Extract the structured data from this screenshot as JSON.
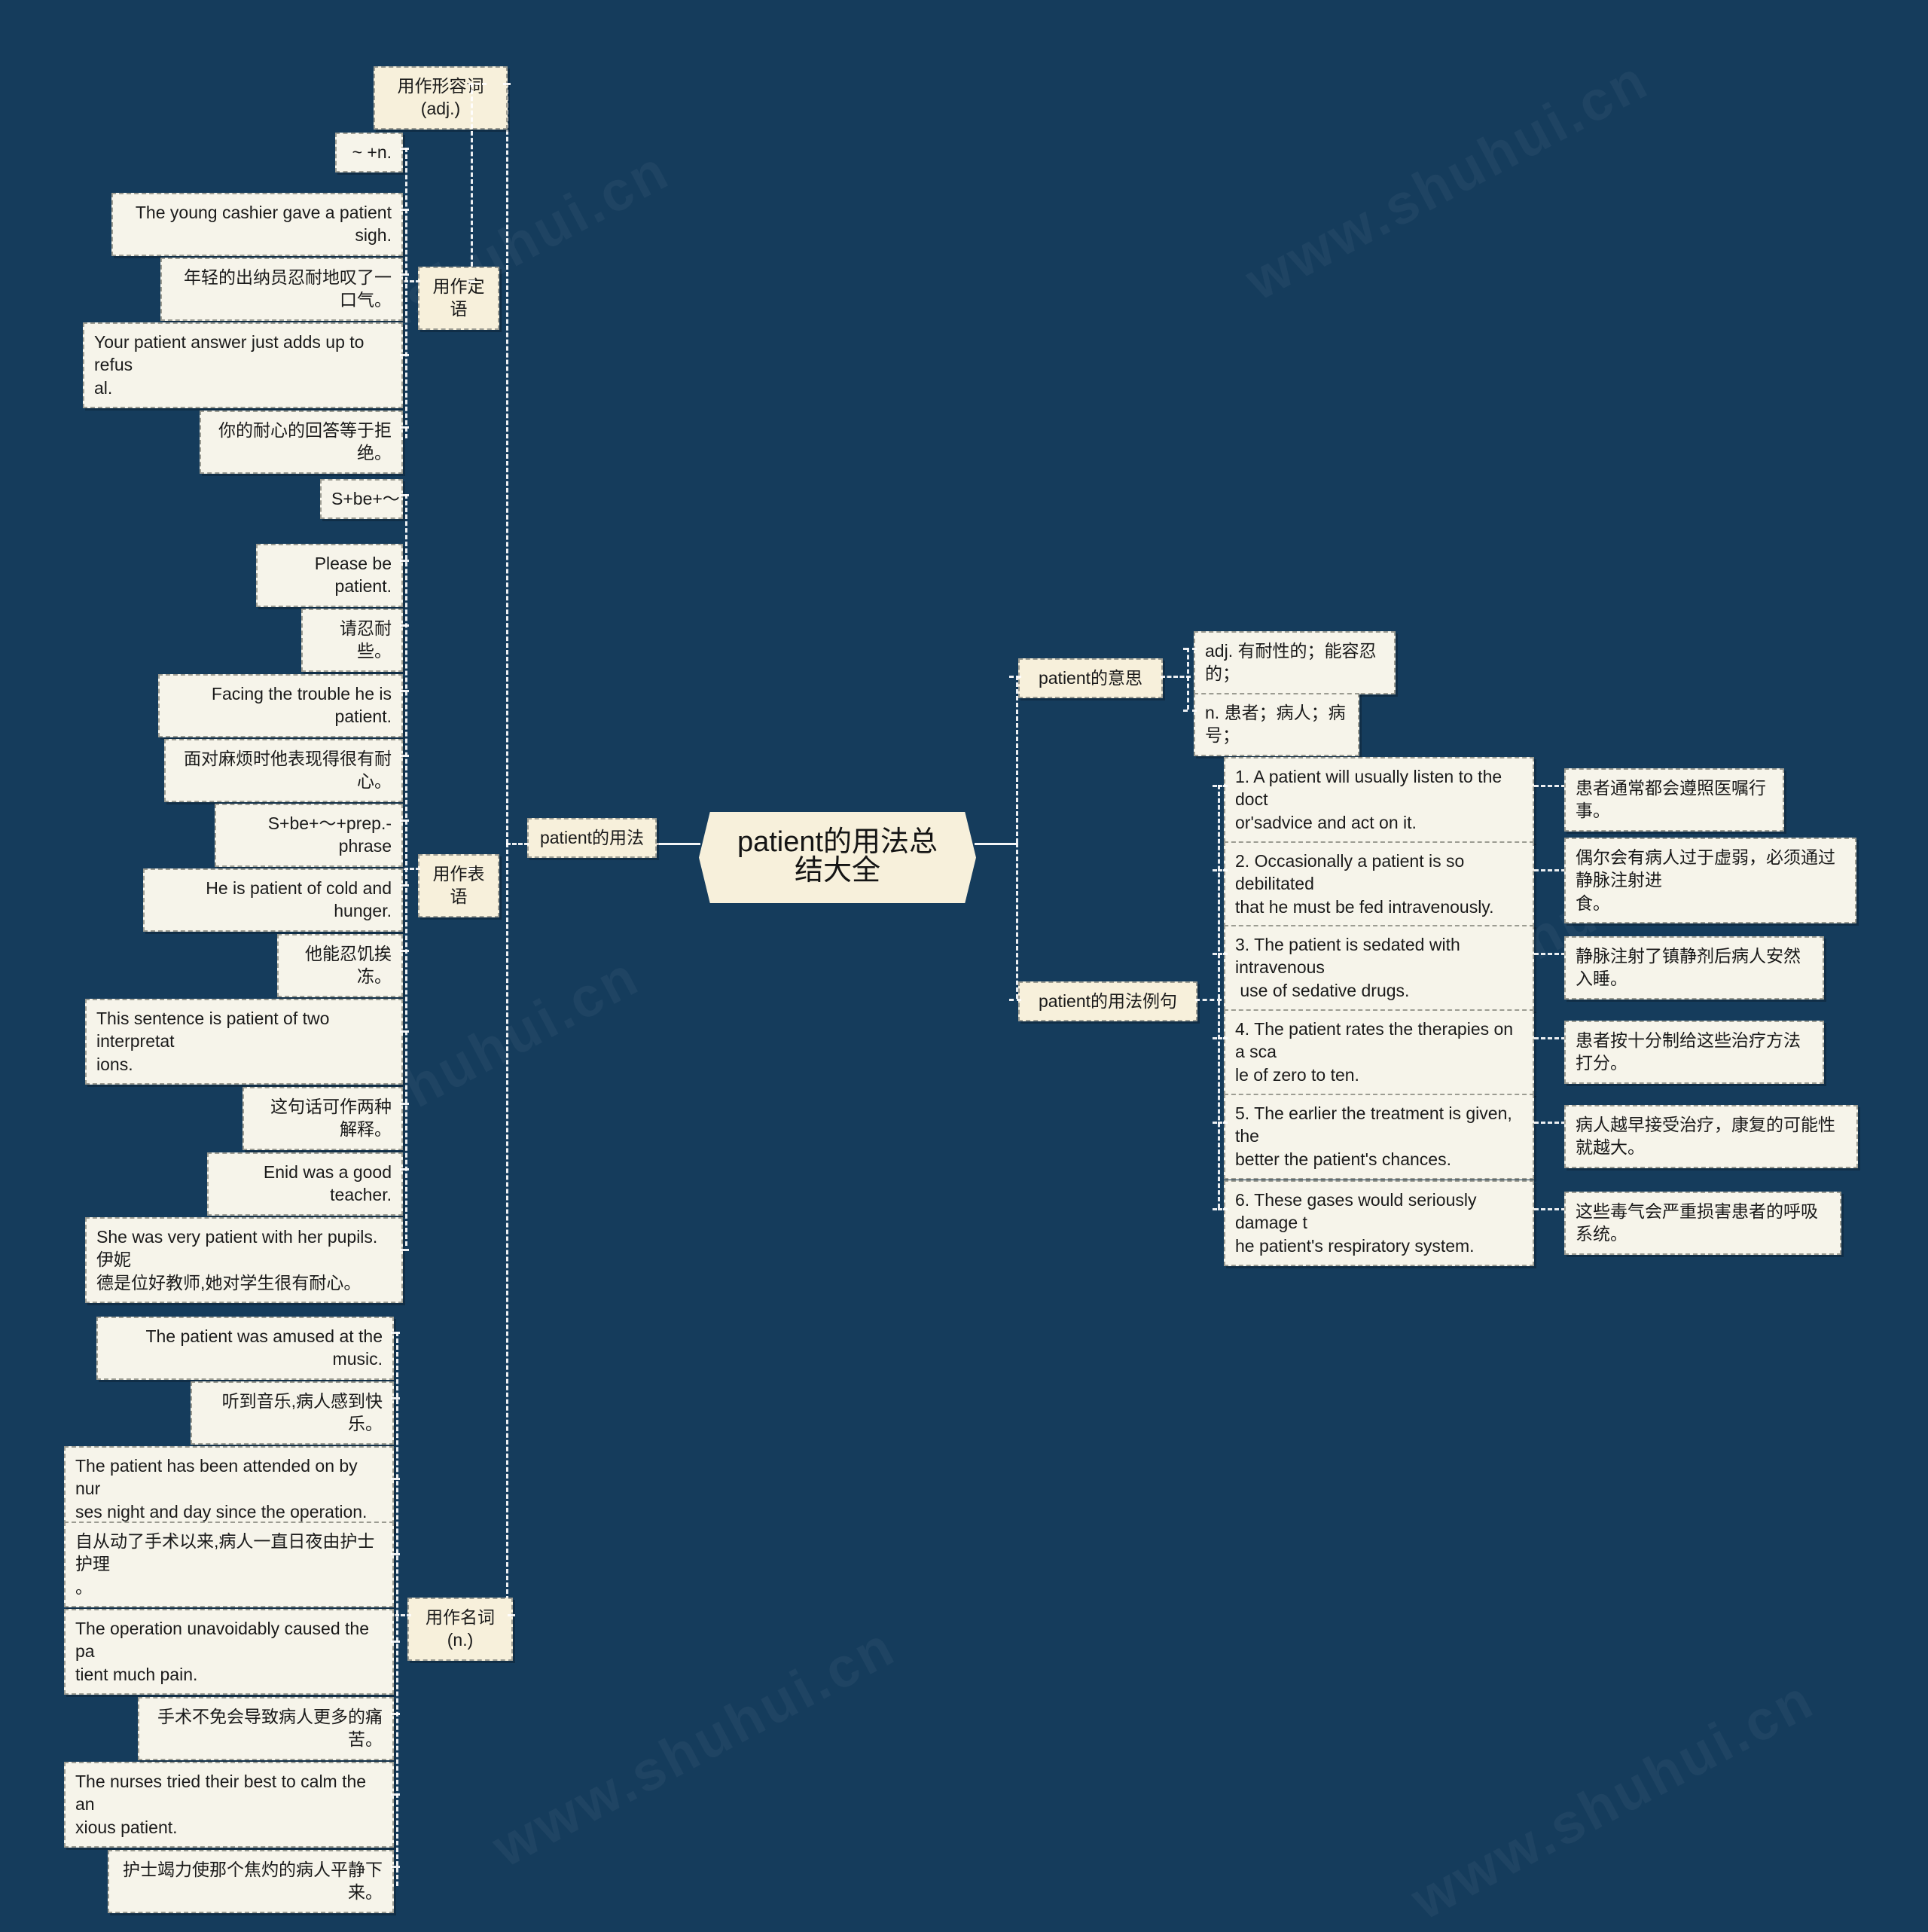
{
  "root": {
    "label": "patient的用法总结大全"
  },
  "watermarks": [
    {
      "text": "www.shuhui.cn"
    },
    {
      "text": "www.shuhui.cn"
    },
    {
      "text": "www.shuhui.cn"
    },
    {
      "text": "www.shuhui.cn"
    },
    {
      "text": "www.shuhui.cn"
    },
    {
      "text": "www.shuhui.cn"
    }
  ],
  "left": {
    "branch_label": "patient的用法",
    "categories": {
      "adj": "用作形容词(adj.)",
      "attributive": "用作定语",
      "predicative": "用作表语",
      "noun": "用作名词(n.)"
    },
    "attributive_items": [
      {
        "text": "~ +n."
      },
      {
        "text": "The young cashier gave a patient sigh."
      },
      {
        "text": "年轻的出纳员忍耐地叹了一口气。"
      },
      {
        "text": "Your patient answer just adds up to refus\nal."
      },
      {
        "text": "你的耐心的回答等于拒绝。"
      }
    ],
    "predicative_items": [
      {
        "text": "S+be+～"
      },
      {
        "text": "Please be patient."
      },
      {
        "text": "请忍耐些。"
      },
      {
        "text": "Facing the trouble he is patient."
      },
      {
        "text": "面对麻烦时他表现得很有耐心。"
      },
      {
        "text": "S+be+～+prep.-phrase"
      },
      {
        "text": "He is patient of cold and hunger."
      },
      {
        "text": "他能忍饥挨冻。"
      },
      {
        "text": "This sentence is patient of two interpretat\nions."
      },
      {
        "text": "这句话可作两种解释。"
      },
      {
        "text": "Enid was a good teacher."
      },
      {
        "text": "She was very patient with her pupils.伊妮\n德是位好教师,她对学生很有耐心。"
      }
    ],
    "noun_items": [
      {
        "text": "The patient was amused at the music."
      },
      {
        "text": "听到音乐,病人感到快乐。"
      },
      {
        "text": "The patient has been attended on by nur\nses night and day since the operation."
      },
      {
        "text": "自从动了手术以来,病人一直日夜由护士护理\n。"
      },
      {
        "text": "The operation unavoidably caused the pa\ntient much pain."
      },
      {
        "text": "手术不免会导致病人更多的痛苦。"
      },
      {
        "text": "The nurses tried their best to calm the an\nxious patient."
      },
      {
        "text": "护士竭力使那个焦灼的病人平静下来。"
      }
    ]
  },
  "right": {
    "meaning_label": "patient的意思",
    "meanings": [
      {
        "text": "adj. 有耐性的；能容忍的；"
      },
      {
        "text": "n. 患者；病人；病号；"
      }
    ],
    "examples_label": "patient的用法例句",
    "examples": [
      {
        "en": "1. A patient will usually listen to the doct\nor'sadvice and act on it.",
        "zh": "患者通常都会遵照医嘱行事。"
      },
      {
        "en": "2. Occasionally a patient is so debilitated\nthat he must be fed intravenously.",
        "zh": "偶尔会有病人过于虚弱，必须通过静脉注射进\n食。"
      },
      {
        "en": "3. The patient is sedated with intravenous\n use of sedative drugs.",
        "zh": "静脉注射了镇静剂后病人安然入睡。"
      },
      {
        "en": "4. The patient rates the therapies on a sca\nle of zero to ten.",
        "zh": "患者按十分制给这些治疗方法打分。"
      },
      {
        "en": "5. The earlier the treatment is given, the\nbetter the patient's chances.",
        "zh": "病人越早接受治疗，康复的可能性就越大。"
      },
      {
        "en": "6. These gases would seriously damage t\nhe patient's respiratory system.",
        "zh": "这些毒气会严重损害患者的呼吸系统。"
      }
    ]
  },
  "colors": {
    "background": "#153C5C",
    "node_fill": "#F6F4EA",
    "category_fill": "#F7F0DB",
    "connector": "#FFFFFF",
    "text": "#1A1A1A"
  }
}
